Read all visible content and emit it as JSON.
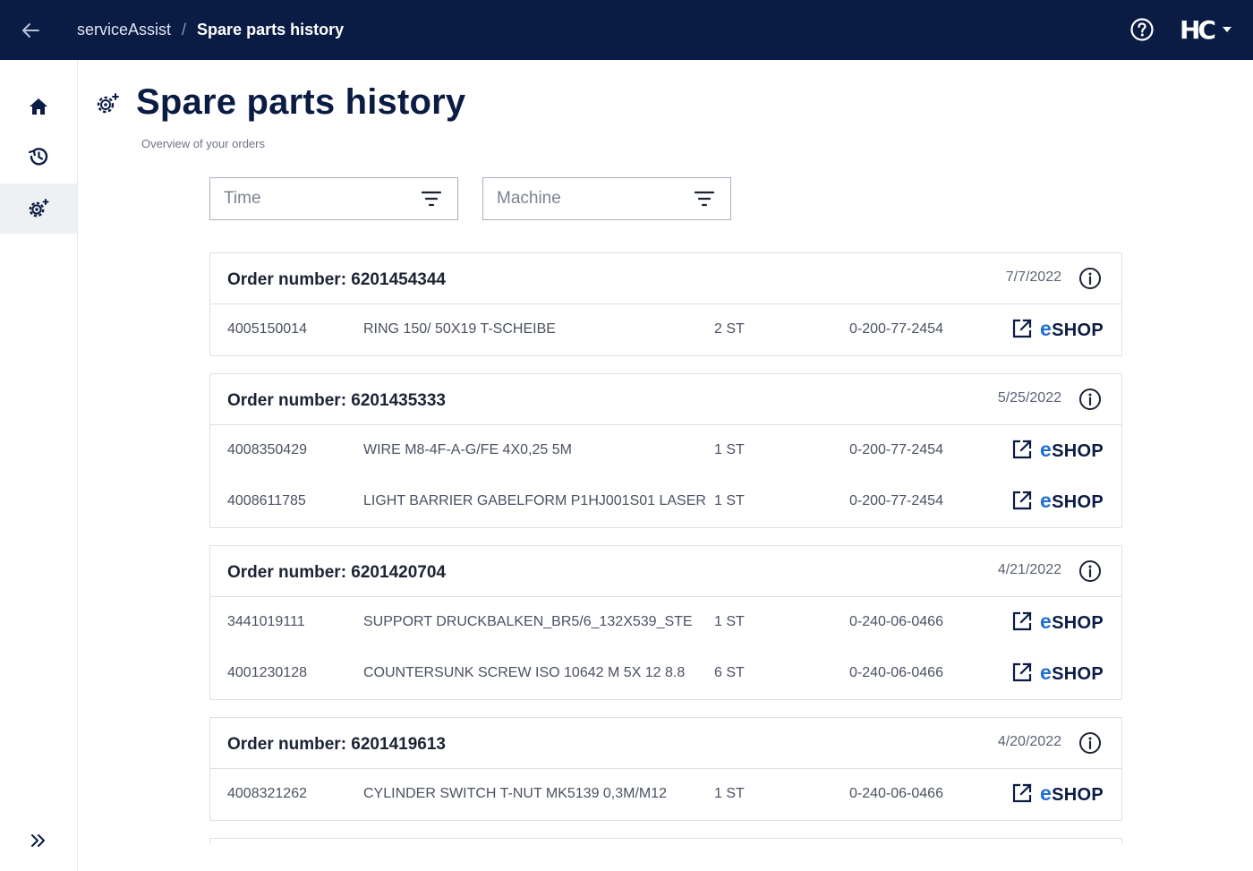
{
  "topbar": {
    "app_name": "serviceAssist",
    "separator": "/",
    "current_page": "Spare parts history",
    "brand_logo": "HC",
    "background": "#0b1c44"
  },
  "sidebar": {
    "items": [
      {
        "name": "home",
        "icon": "home-icon"
      },
      {
        "name": "history",
        "icon": "history-icon"
      },
      {
        "name": "spare-parts",
        "icon": "gear-icon",
        "active": true
      }
    ],
    "expand_icon": "double-chevron-right-icon"
  },
  "page": {
    "title": "Spare parts history",
    "subtitle": "Overview of your orders"
  },
  "filters": [
    {
      "label": "Time"
    },
    {
      "label": "Machine"
    }
  ],
  "eshop_label_prefix": "e",
  "eshop_label": "SHOP",
  "accent_color": "#1f6fd1",
  "orders": [
    {
      "title": "Order number: 6201454344",
      "date": "7/7/2022",
      "items": [
        {
          "part": "4005150014",
          "desc": "RING 150/ 50X19 T-SCHEIBE",
          "qty": "2 ST",
          "machine": "0-200-77-2454"
        }
      ]
    },
    {
      "title": "Order number: 6201435333",
      "date": "5/25/2022",
      "items": [
        {
          "part": "4008350429",
          "desc": "WIRE M8-4F-A-G/FE 4X0,25 5M",
          "qty": "1 ST",
          "machine": "0-200-77-2454"
        },
        {
          "part": "4008611785",
          "desc": "LIGHT BARRIER GABELFORM P1HJ001S01 LASER",
          "qty": "1 ST",
          "machine": "0-200-77-2454"
        }
      ]
    },
    {
      "title": "Order number: 6201420704",
      "date": "4/21/2022",
      "items": [
        {
          "part": "3441019111",
          "desc": "SUPPORT DRUCKBALKEN_BR5/6_132X539_STE",
          "qty": "1 ST",
          "machine": "0-240-06-0466"
        },
        {
          "part": "4001230128",
          "desc": "COUNTERSUNK SCREW ISO 10642 M 5X 12 8.8",
          "qty": "6 ST",
          "machine": "0-240-06-0466"
        }
      ]
    },
    {
      "title": "Order number: 6201419613",
      "date": "4/20/2022",
      "items": [
        {
          "part": "4008321262",
          "desc": "CYLINDER SWITCH T-NUT MK5139 0,3M/M12",
          "qty": "1 ST",
          "machine": "0-240-06-0466"
        }
      ]
    }
  ]
}
